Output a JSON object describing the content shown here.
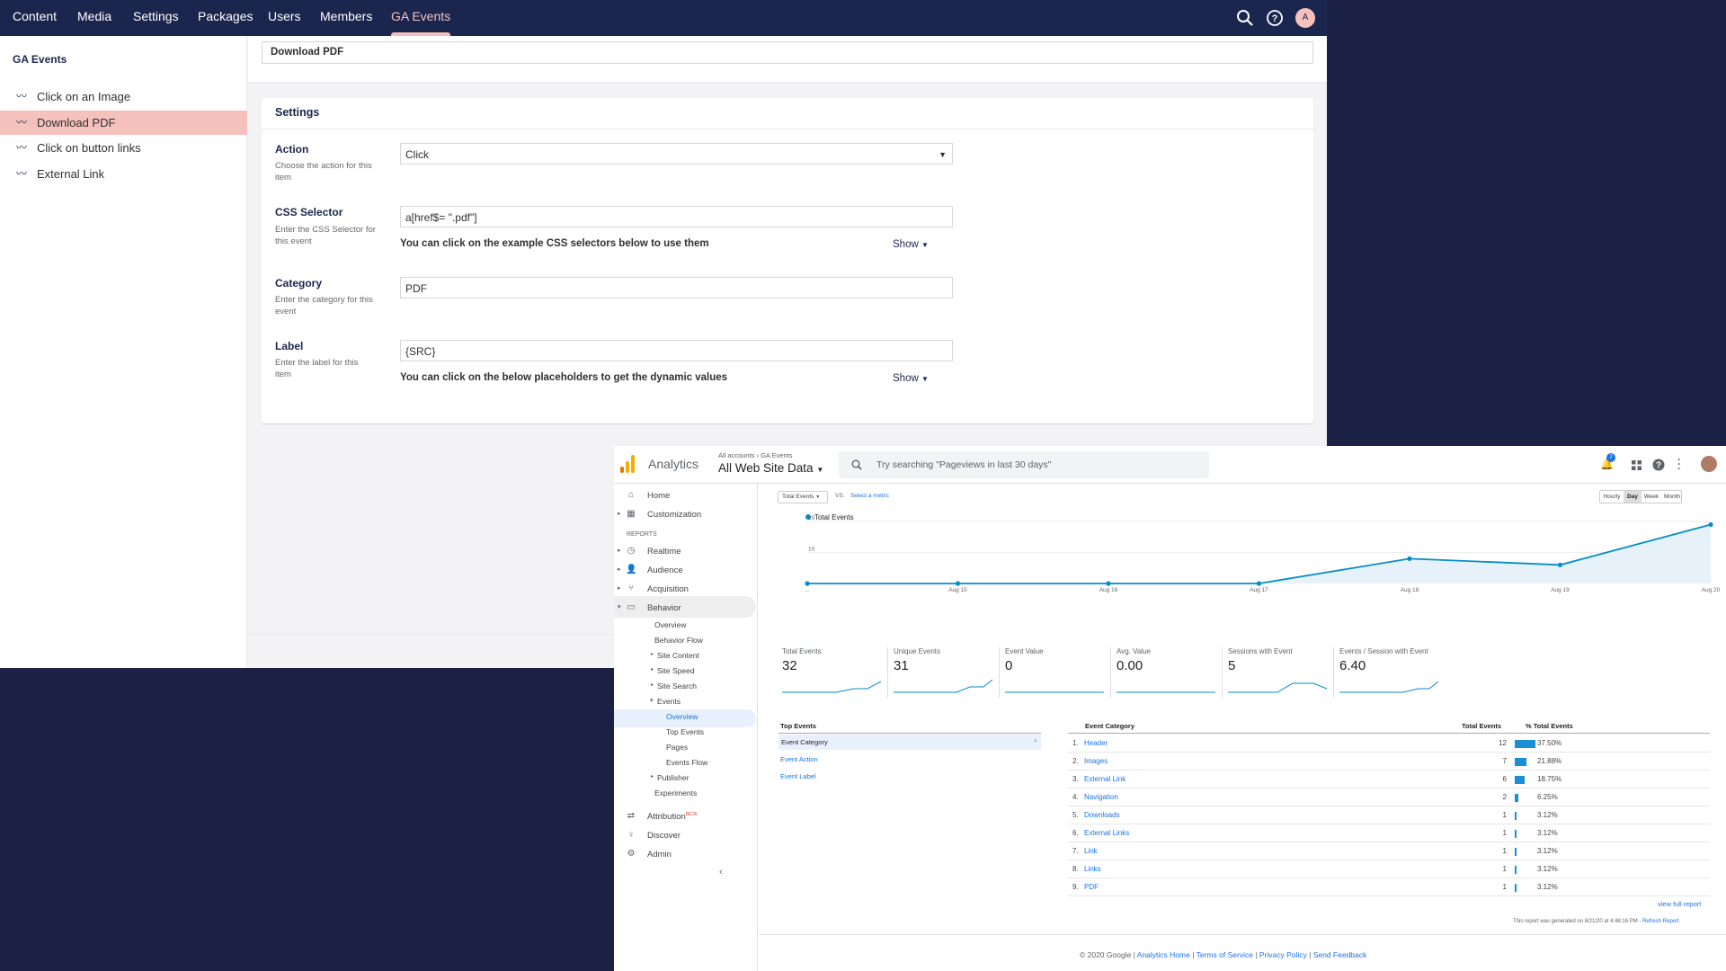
{
  "umbraco": {
    "nav": [
      "Content",
      "Media",
      "Settings",
      "Packages",
      "Users",
      "Members",
      "GA Events"
    ],
    "avatar_initial": "A",
    "section_title": "GA Events",
    "tree": [
      "Click on an Image",
      "Download PDF",
      "Click on button links",
      "External Link"
    ],
    "name_value": "Download PDF",
    "settings_title": "Settings",
    "fields": {
      "action": {
        "label": "Action",
        "desc": "Choose the action for this item",
        "value": "Click"
      },
      "css": {
        "label": "CSS Selector",
        "desc": "Enter the CSS Selector for this event",
        "value": "a[href$= \".pdf\"]",
        "hint": "You can click on the example CSS selectors below to use them",
        "show": "Show"
      },
      "category": {
        "label": "Category",
        "desc": "Enter the category for this event",
        "value": "PDF"
      },
      "label": {
        "label": "Label",
        "desc": "Enter the label for this item",
        "value": "{SRC}",
        "hint": "You can click on the below placeholders to get the dynamic values",
        "show": "Show"
      }
    }
  },
  "ga": {
    "brand": "Analytics",
    "breadcrumb": "All accounts › GA Events",
    "view": "All Web Site Data",
    "search_placeholder": "Try searching \"Pageviews in last 30 days\"",
    "notif_count": "7",
    "sidebar": {
      "home": "Home",
      "customization": "Customization",
      "reports_header": "REPORTS",
      "realtime": "Realtime",
      "audience": "Audience",
      "acquisition": "Acquisition",
      "behavior": "Behavior",
      "overview": "Overview",
      "behavior_flow": "Behavior Flow",
      "site_content": "Site Content",
      "site_speed": "Site Speed",
      "site_search": "Site Search",
      "events": "Events",
      "events_overview": "Overview",
      "top_events": "Top Events",
      "pages": "Pages",
      "events_flow": "Events Flow",
      "publisher": "Publisher",
      "experiments": "Experiments",
      "attribution": "Attribution",
      "beta": "BETA",
      "discover": "Discover",
      "admin": "Admin"
    },
    "metric_select": "Total Events",
    "vs": "VS.",
    "select_metric": "Select a metric",
    "granularity": [
      "Hourly",
      "Day",
      "Week",
      "Month"
    ],
    "chart_data": {
      "type": "area",
      "series": [
        {
          "name": "Total Events",
          "values": [
            0,
            0,
            0,
            0,
            8,
            6,
            19
          ]
        }
      ],
      "x": [
        "...",
        "Aug 15",
        "Aug 16",
        "Aug 17",
        "Aug 18",
        "Aug 19",
        "Aug 20"
      ],
      "yticks": [
        10,
        20
      ],
      "ylim": [
        0,
        20
      ],
      "legend": "top-left",
      "color": "#058dc7"
    },
    "metrics": [
      {
        "label": "Total Events",
        "value": "32"
      },
      {
        "label": "Unique Events",
        "value": "31"
      },
      {
        "label": "Event Value",
        "value": "0"
      },
      {
        "label": "Avg. Value",
        "value": "0.00"
      },
      {
        "label": "Sessions with Event",
        "value": "5"
      },
      {
        "label": "Events / Session with Event",
        "value": "6.40"
      }
    ],
    "top_events": {
      "title": "Top Events",
      "items": [
        "Event Category",
        "Event Action",
        "Event Label"
      ]
    },
    "table": {
      "headers": [
        "Event Category",
        "Total Events",
        "% Total Events"
      ],
      "rows": [
        {
          "n": "1.",
          "cat": "Header",
          "val": "12",
          "pct": "37.50%",
          "frac": 0.375
        },
        {
          "n": "2.",
          "cat": "Images",
          "val": "7",
          "pct": "21.88%",
          "frac": 0.2188
        },
        {
          "n": "3.",
          "cat": "External Link",
          "val": "6",
          "pct": "18.75%",
          "frac": 0.1875
        },
        {
          "n": "4.",
          "cat": "Navigation",
          "val": "2",
          "pct": "6.25%",
          "frac": 0.0625
        },
        {
          "n": "5.",
          "cat": "Downloads",
          "val": "1",
          "pct": "3.12%",
          "frac": 0.0312
        },
        {
          "n": "6.",
          "cat": "External Links",
          "val": "1",
          "pct": "3.12%",
          "frac": 0.0312
        },
        {
          "n": "7.",
          "cat": "Link",
          "val": "1",
          "pct": "3.12%",
          "frac": 0.0312
        },
        {
          "n": "8.",
          "cat": "Links",
          "val": "1",
          "pct": "3.12%",
          "frac": 0.0312
        },
        {
          "n": "9.",
          "cat": "PDF",
          "val": "1",
          "pct": "3.12%",
          "frac": 0.0312
        }
      ]
    },
    "view_full_report": "view full report",
    "generated": "This report was generated on 8/21/20 at 4:48:16 PM -",
    "refresh": "Refresh Report",
    "footer": {
      "copyright": "© 2020 Google |",
      "links": [
        "Analytics Home",
        "Terms of Service",
        "Privacy Policy",
        "Send Feedback"
      ]
    }
  }
}
